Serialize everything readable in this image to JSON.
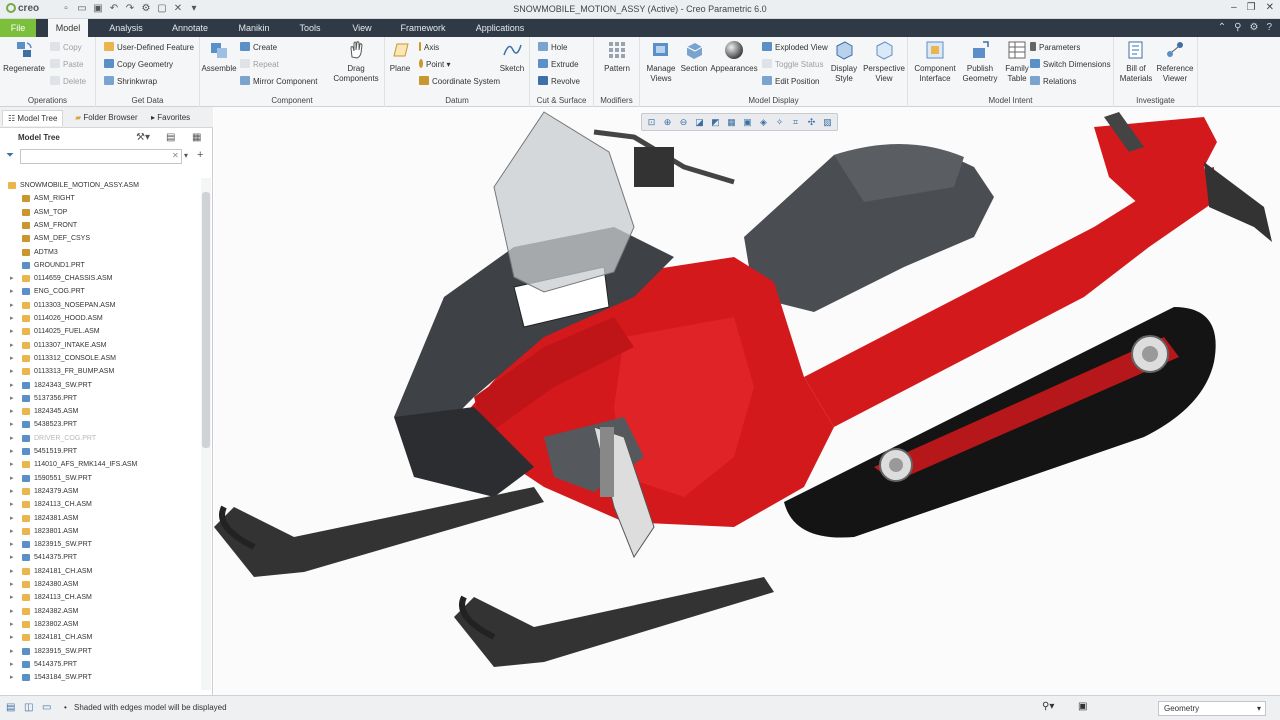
{
  "app": {
    "logo": "creo",
    "window_title": "SNOWMOBILE_MOTION_ASSY (Active) - Creo Parametric 6.0"
  },
  "tabs": [
    "File",
    "Model",
    "Analysis",
    "Annotate",
    "Manikin",
    "Tools",
    "View",
    "Framework",
    "Applications"
  ],
  "ribbon": {
    "operations": {
      "label": "Operations",
      "regenerate": "Regenerate",
      "copy": "Copy",
      "paste": "Paste",
      "delete": "Delete"
    },
    "getdata": {
      "label": "Get Data",
      "udf": "User-Defined Feature",
      "copy_geometry": "Copy Geometry",
      "shrinkwrap": "Shrinkwrap"
    },
    "component": {
      "label": "Component",
      "assemble": "Assemble",
      "create": "Create",
      "repeat": "Repeat",
      "mirror": "Mirror Component",
      "drag": "Drag Components"
    },
    "datum": {
      "label": "Datum",
      "plane": "Plane",
      "axis": "Axis",
      "point": "Point",
      "csys": "Coordinate System",
      "sketch": "Sketch"
    },
    "cutsurface": {
      "label": "Cut & Surface",
      "hole": "Hole",
      "extrude": "Extrude",
      "revolve": "Revolve"
    },
    "modifiers": {
      "label": "Modifiers",
      "pattern": "Pattern"
    },
    "modeldisplay": {
      "label": "Model Display",
      "manage_views": "Manage Views",
      "section": "Section",
      "appearances": "Appearances",
      "exploded": "Exploded View",
      "toggle": "Toggle Status",
      "edit_position": "Edit Position",
      "display_style": "Display Style",
      "perspective": "Perspective View"
    },
    "modelintent": {
      "label": "Model Intent",
      "component_interface": "Component Interface",
      "publish_geometry": "Publish Geometry",
      "family_table": "Family Table",
      "parameters": "Parameters",
      "switch_dimensions": "Switch Dimensions",
      "relations": "Relations"
    },
    "investigate": {
      "label": "Investigate",
      "bom": "Bill of Materials",
      "reference_viewer": "Reference Viewer"
    }
  },
  "panel": {
    "tabs": [
      "Model Tree",
      "Folder Browser",
      "Favorites"
    ],
    "header": "Model Tree",
    "filter_placeholder": ""
  },
  "tree": [
    {
      "t": "SNOWMOBILE_MOTION_ASSY.ASM",
      "k": "asm",
      "l": 0
    },
    {
      "t": "ASM_RIGHT",
      "k": "datum",
      "l": 1
    },
    {
      "t": "ASM_TOP",
      "k": "datum",
      "l": 1
    },
    {
      "t": "ASM_FRONT",
      "k": "datum",
      "l": 1
    },
    {
      "t": "ASM_DEF_CSYS",
      "k": "csys",
      "l": 1
    },
    {
      "t": "ADTM3",
      "k": "datum",
      "l": 1
    },
    {
      "t": "GROUND1.PRT",
      "k": "prt",
      "l": 1
    },
    {
      "t": "0114659_CHASSIS.ASM",
      "k": "asm",
      "l": 1,
      "e": 1
    },
    {
      "t": "ENG_COG.PRT",
      "k": "prt",
      "l": 1,
      "e": 1
    },
    {
      "t": "0113303_NOSEPAN.ASM",
      "k": "asm",
      "l": 1,
      "e": 1
    },
    {
      "t": "0114026_HOOD.ASM",
      "k": "asm",
      "l": 1,
      "e": 1
    },
    {
      "t": "0114025_FUEL.ASM",
      "k": "asm",
      "l": 1,
      "e": 1
    },
    {
      "t": "0113307_INTAKE.ASM",
      "k": "asm",
      "l": 1,
      "e": 1
    },
    {
      "t": "0113312_CONSOLE.ASM",
      "k": "asm",
      "l": 1,
      "e": 1
    },
    {
      "t": "0113313_FR_BUMP.ASM",
      "k": "asm",
      "l": 1,
      "e": 1
    },
    {
      "t": "1824343_SW.PRT",
      "k": "prt",
      "l": 1,
      "e": 1
    },
    {
      "t": "5137356.PRT",
      "k": "prt",
      "l": 1,
      "e": 1
    },
    {
      "t": "1824345.ASM",
      "k": "asm",
      "l": 1,
      "e": 1
    },
    {
      "t": "5438523.PRT",
      "k": "prt",
      "l": 1,
      "e": 1
    },
    {
      "t": "DRIVER_COG.PRT",
      "k": "prt",
      "l": 1,
      "e": 1,
      "d": 1
    },
    {
      "t": "5451519.PRT",
      "k": "prt",
      "l": 1,
      "e": 1
    },
    {
      "t": "114010_AFS_RMK144_IFS.ASM",
      "k": "asm",
      "l": 1,
      "e": 1
    },
    {
      "t": "1590551_SW.PRT",
      "k": "prt",
      "l": 1,
      "e": 1
    },
    {
      "t": "1824379.ASM",
      "k": "asm",
      "l": 1,
      "e": 1
    },
    {
      "t": "1824113_CH.ASM",
      "k": "asm",
      "l": 1,
      "e": 1
    },
    {
      "t": "1824381.ASM",
      "k": "asm",
      "l": 1,
      "e": 1
    },
    {
      "t": "1823801.ASM",
      "k": "asm",
      "l": 1,
      "e": 1
    },
    {
      "t": "1823915_SW.PRT",
      "k": "prt",
      "l": 1,
      "e": 1
    },
    {
      "t": "5414375.PRT",
      "k": "prt",
      "l": 1,
      "e": 1
    },
    {
      "t": "1824181_CH.ASM",
      "k": "asm",
      "l": 1,
      "e": 1
    },
    {
      "t": "1824380.ASM",
      "k": "asm",
      "l": 1,
      "e": 1
    },
    {
      "t": "1824113_CH.ASM",
      "k": "asm",
      "l": 1,
      "e": 1
    },
    {
      "t": "1824382.ASM",
      "k": "asm",
      "l": 1,
      "e": 1
    },
    {
      "t": "1823802.ASM",
      "k": "asm",
      "l": 1,
      "e": 1
    },
    {
      "t": "1824181_CH.ASM",
      "k": "asm",
      "l": 1,
      "e": 1
    },
    {
      "t": "1823915_SW.PRT",
      "k": "prt",
      "l": 1,
      "e": 1
    },
    {
      "t": "5414375.PRT",
      "k": "prt",
      "l": 1,
      "e": 1
    },
    {
      "t": "1543184_SW.PRT",
      "k": "prt",
      "l": 1,
      "e": 1
    }
  ],
  "status": {
    "message": "Shaded with edges model will be displayed",
    "filter": "Geometry"
  },
  "colors": {
    "accent": "#7bbf3a",
    "tabbar": "#2f3a46",
    "body_red": "#d4191c",
    "dark_gray": "#4a4d52"
  }
}
